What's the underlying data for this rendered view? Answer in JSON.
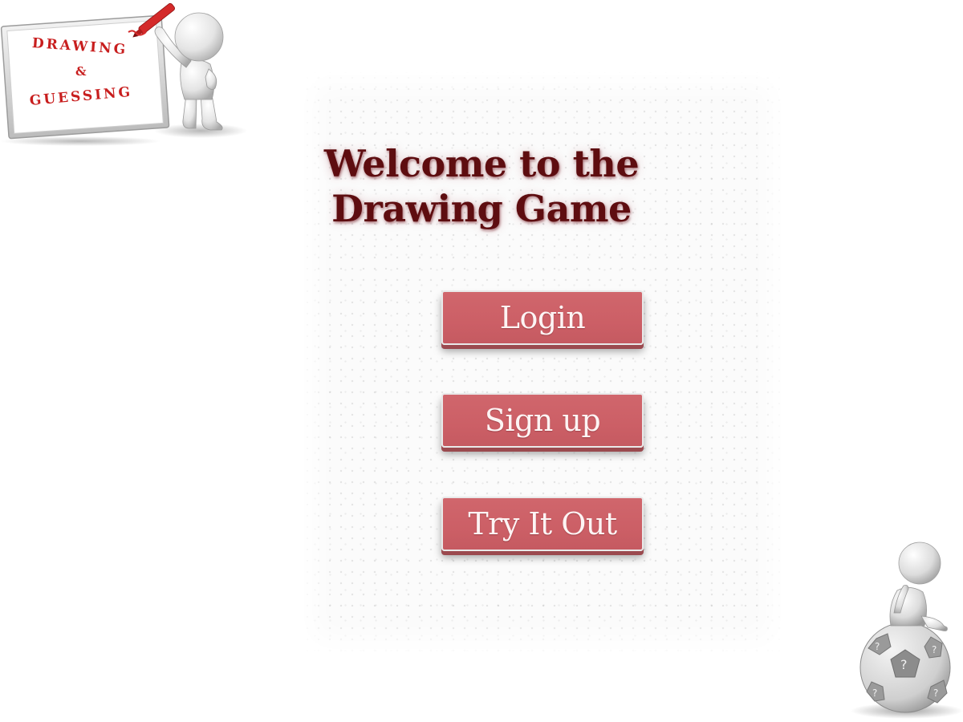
{
  "logo": {
    "line1": "DRAWING",
    "line2": "&",
    "line3": "GUESSING",
    "icon": "presenter-figure-whiteboard-icon"
  },
  "welcome": {
    "line1": "Welcome to the",
    "line2": "Drawing Game"
  },
  "buttons": {
    "login": "Login",
    "signup": "Sign up",
    "try": "Try It Out"
  },
  "decoration": {
    "icon": "thinking-figure-question-ball-icon"
  },
  "colors": {
    "button_fill": "#cc5f66",
    "button_text": "#fdf4f4",
    "title_color": "#5e0d10",
    "logo_text": "#c81e1e"
  }
}
